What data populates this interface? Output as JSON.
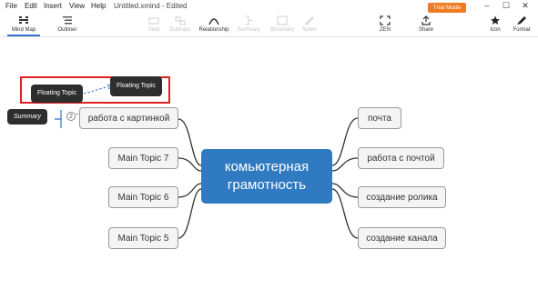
{
  "menubar": {
    "items": [
      "File",
      "Edit",
      "Insert",
      "View",
      "Help"
    ],
    "document_title": "Untitled.xmind - Edited",
    "trial_label": "Trial Mode",
    "window_controls": [
      "minimize-icon",
      "maximize-icon",
      "close-icon"
    ]
  },
  "toolbar": {
    "mindmap": "Mind Map",
    "outliner": "Outliner",
    "topic": "Topic",
    "subtopic": "Subtopic",
    "relationship": "Relationship",
    "summary": "Summary",
    "boundary": "Boundary",
    "notes": "Notes",
    "zen": "ZEN",
    "share": "Share",
    "icon": "Icon",
    "format": "Format"
  },
  "map": {
    "central": "комьютерная грамотность",
    "left": [
      "работа с картинкой",
      "Main Topic 7",
      "Main Topic 6",
      "Main Topic 5"
    ],
    "right": [
      "почта",
      "работа с почтой",
      "создание ролика",
      "создание канала"
    ],
    "floating_1": "Floating Topic",
    "floating_2": "Floating Topic",
    "summary": "Summary",
    "collapse_count": "2"
  },
  "colors": {
    "central": "#2f7ac0",
    "highlight": "#e02020",
    "trial": "#f07b23",
    "connector": "#333333",
    "relationship": "#2f6fd0"
  }
}
